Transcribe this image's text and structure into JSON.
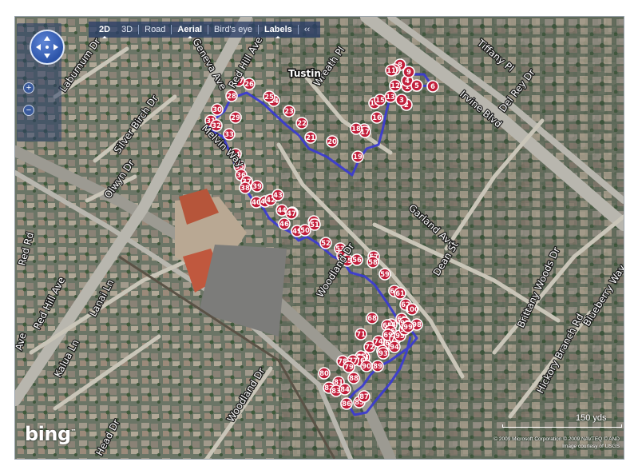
{
  "toolbar": {
    "items": [
      {
        "label": "2D",
        "active": true
      },
      {
        "label": "3D",
        "active": false
      },
      {
        "label": "Road",
        "active": false
      },
      {
        "label": "Aerial",
        "active": true
      },
      {
        "label": "Bird's eye",
        "active": false
      },
      {
        "label": "Labels",
        "active": true
      },
      {
        "label": "‹‹",
        "active": false
      }
    ]
  },
  "zoom": {
    "in_label": "+",
    "out_label": "−"
  },
  "town_label": "Tustin",
  "streets": [
    {
      "id": "laburnum",
      "name": "Laburnum Dr"
    },
    {
      "id": "silverbirch",
      "name": "Silver Birch Dr"
    },
    {
      "id": "olwyn",
      "name": "Olwyn Dr"
    },
    {
      "id": "redhill_l",
      "name": "Red Hill Ave"
    },
    {
      "id": "redhill_t",
      "name": "Red Hill Ave"
    },
    {
      "id": "red_rd",
      "name": "Red Rd"
    },
    {
      "id": "geneva",
      "name": "Geneva Ave"
    },
    {
      "id": "wreath",
      "name": "Wreath Pl"
    },
    {
      "id": "tiffany",
      "name": "Tiffany Pl"
    },
    {
      "id": "irvine",
      "name": "Irvine Blvd"
    },
    {
      "id": "delrey",
      "name": "Del Rey Dr"
    },
    {
      "id": "melvin",
      "name": "Melvin Way"
    },
    {
      "id": "garland",
      "name": "Garland Ave"
    },
    {
      "id": "dean",
      "name": "Dean St"
    },
    {
      "id": "woodland",
      "name": "Woodland Dr"
    },
    {
      "id": "woodland2",
      "name": "Woodland Dr"
    },
    {
      "id": "brittany",
      "name": "Brittany Woods Dr"
    },
    {
      "id": "blueberry",
      "name": "Blueberry Way"
    },
    {
      "id": "hickory",
      "name": "Hickory Branch Rd"
    },
    {
      "id": "lanai",
      "name": "Lanai Ln"
    },
    {
      "id": "kalua",
      "name": "Kalua Ln"
    },
    {
      "id": "head",
      "name": "Head Dr"
    },
    {
      "id": "ave_l",
      "name": "Ave"
    }
  ],
  "route_markers": [
    "1",
    "2",
    "3",
    "4",
    "5",
    "6",
    "7",
    "8",
    "9",
    "10",
    "11",
    "12",
    "13",
    "14",
    "15",
    "16",
    "17",
    "18",
    "19",
    "20",
    "21",
    "22",
    "23",
    "24",
    "25",
    "26",
    "27",
    "28",
    "29",
    "30",
    "31",
    "32",
    "33",
    "34",
    "35",
    "36",
    "37",
    "38",
    "39",
    "40",
    "41",
    "42",
    "43",
    "44",
    "45",
    "46",
    "47",
    "48",
    "49",
    "50",
    "51",
    "52",
    "53",
    "54",
    "55",
    "56",
    "57",
    "58",
    "59",
    "60",
    "61",
    "62",
    "63",
    "64",
    "65",
    "66",
    "67",
    "68",
    "69",
    "70",
    "71",
    "72",
    "73",
    "74",
    "75",
    "76",
    "77",
    "78",
    "79",
    "80",
    "81",
    "82",
    "83",
    "84",
    "85",
    "86",
    "87",
    "88",
    "89",
    "90",
    "91",
    "92",
    "93",
    "94",
    "95",
    "96",
    "97",
    "98",
    "99",
    "100"
  ],
  "scale": {
    "label": "150 yds"
  },
  "logo": "bing",
  "copyright": {
    "line1": "© 2009 Microsoft Corporation   © 2009 NAVTEQ   © AND",
    "line2": "Image courtesy of USGS"
  },
  "colors": {
    "route": "#3c3cd0",
    "pin_fill": "#c21e3a",
    "pin_ring": "#ffffff",
    "panel": "#2a3e68"
  }
}
